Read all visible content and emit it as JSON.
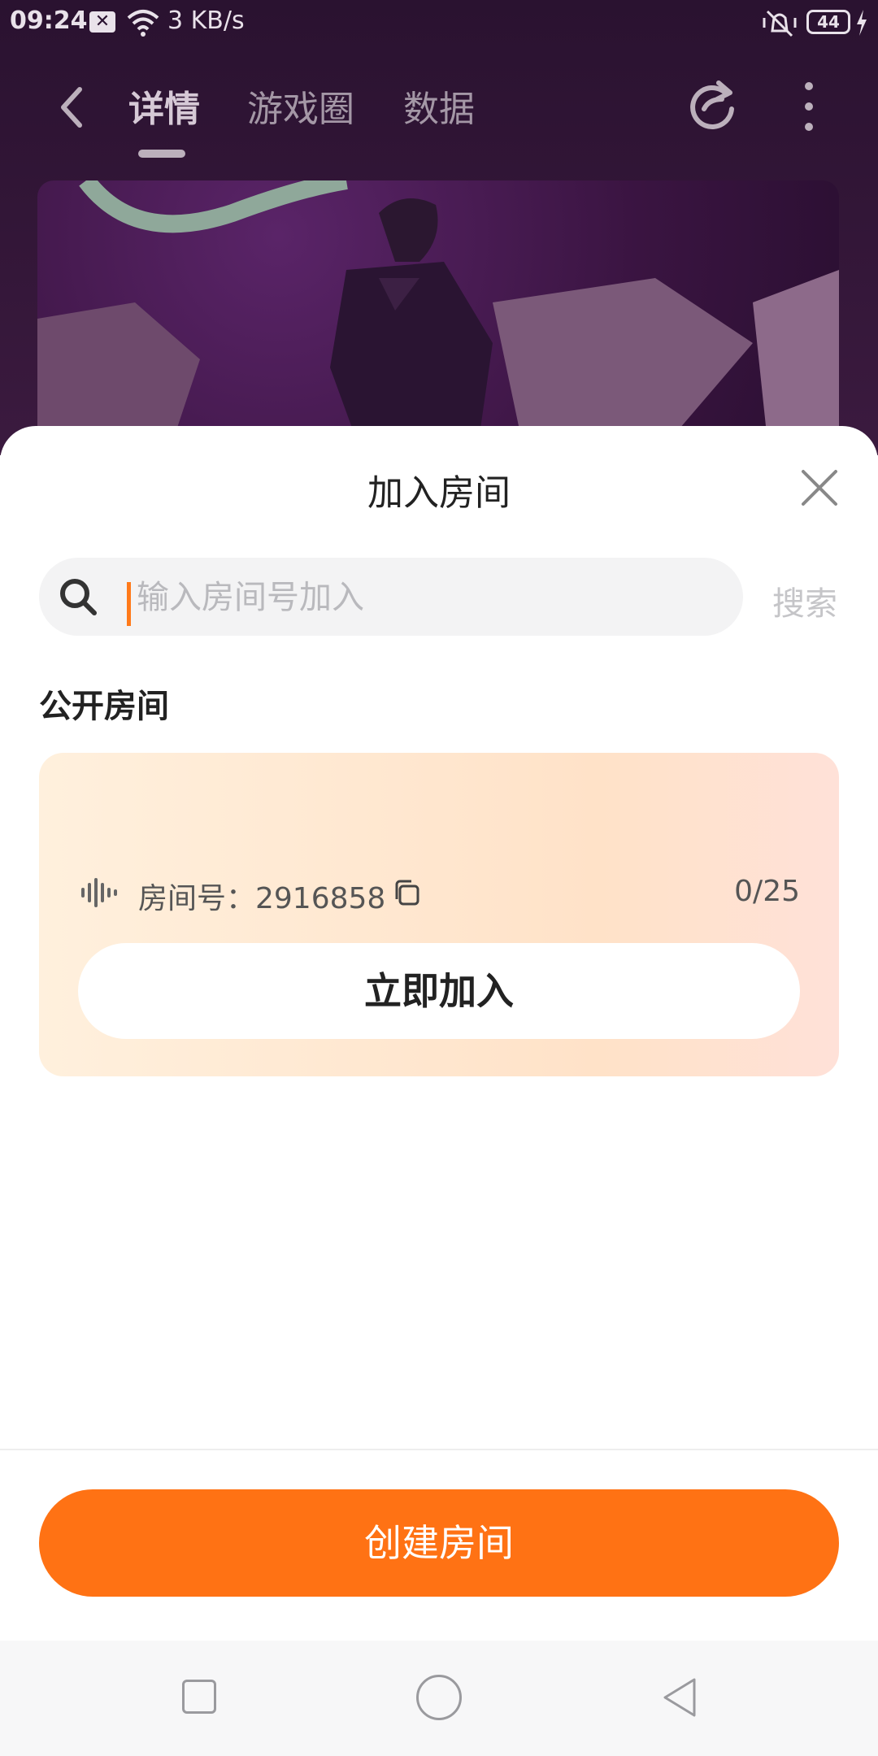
{
  "status_bar": {
    "time": "09:24",
    "speed": "3 KB/s",
    "battery": "44",
    "icons": [
      "notification-close-icon",
      "wifi-icon",
      "vibrate-icon",
      "battery-icon",
      "charging-icon"
    ]
  },
  "header": {
    "tabs": [
      {
        "label": "详情",
        "active": true
      },
      {
        "label": "游戏圈",
        "active": false
      },
      {
        "label": "数据",
        "active": false
      }
    ],
    "icons": [
      "back-icon",
      "refresh-icon",
      "more-icon"
    ]
  },
  "sheet": {
    "title": "加入房间",
    "search": {
      "placeholder": "输入房间号加入",
      "value": "",
      "button_label": "搜索"
    },
    "section_title": "公开房间",
    "room": {
      "id_label": "房间号：2916858",
      "occupancy": "0/25",
      "join_label": "立即加入"
    },
    "create_label": "创建房间"
  },
  "colors": {
    "accent": "#ff7214",
    "header_bg": "#2a1230",
    "card_bg": "#ffe2c8"
  }
}
